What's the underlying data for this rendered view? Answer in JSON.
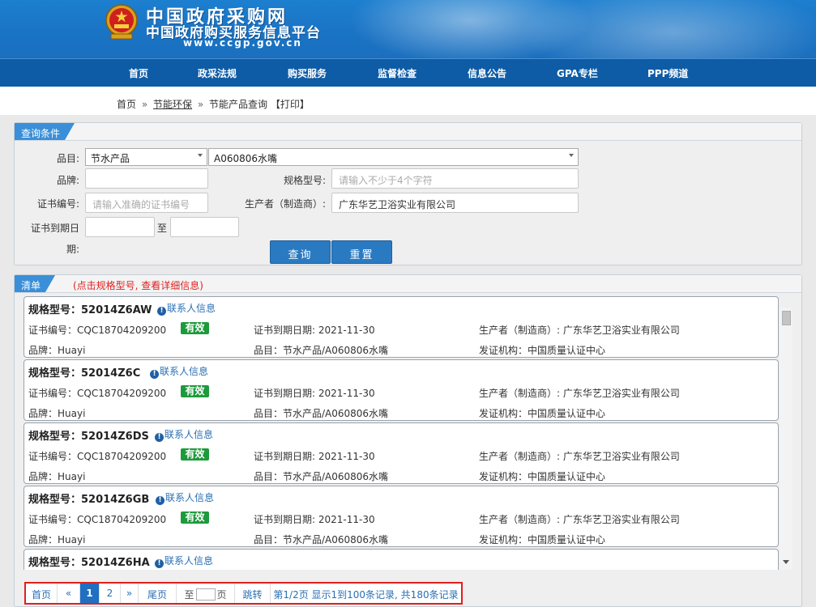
{
  "header": {
    "title": "中国政府采购网",
    "subtitle": "中国政府购买服务信息平台",
    "url": "www.ccgp.gov.cn"
  },
  "nav": [
    "首页",
    "政采法规",
    "购买服务",
    "监督检查",
    "信息公告",
    "GPA专栏",
    "PPP频道"
  ],
  "breadcrumb": {
    "home": "首页",
    "sep": "»",
    "section": "节能环保",
    "page": "节能产品查询",
    "print": "【打印】"
  },
  "query": {
    "tab": "查询条件",
    "category_label": "品目:",
    "category_value": "节水产品",
    "subcategory_value": "A060806水嘴",
    "brand_label": "品牌:",
    "brand_value": "",
    "model_label": "规格型号:",
    "model_placeholder": "请输入不少于4个字符",
    "cert_label": "证书编号:",
    "cert_placeholder": "请输入准确的证书编号",
    "producer_label": "生产者（制造商）:",
    "producer_value": "广东华艺卫浴实业有限公司",
    "expiry_label_1": "证书到期日",
    "expiry_label_2": "期:",
    "to": "至",
    "search_button": "查询",
    "reset_button": "重置"
  },
  "list": {
    "tab": "清单",
    "hint": "(点击规格型号, 查看详细信息)",
    "contact_label": "联系人信息",
    "items": [
      {
        "model": "规格型号：52014Z6AW",
        "cert": "证书编号：CQC18704209200",
        "status": "有效",
        "expiry": "证书到期日期: 2021-11-30",
        "producer": "生产者（制造商）: 广东华艺卫浴实业有限公司",
        "brand": "品牌：Huayi",
        "category": "品目：节水产品/A060806水嘴",
        "issuer": "发证机构：中国质量认证中心"
      },
      {
        "model": "规格型号：52014Z6C",
        "cert": "证书编号：CQC18704209200",
        "status": "有效",
        "expiry": "证书到期日期: 2021-11-30",
        "producer": "生产者（制造商）: 广东华艺卫浴实业有限公司",
        "brand": "品牌：Huayi",
        "category": "品目：节水产品/A060806水嘴",
        "issuer": "发证机构：中国质量认证中心"
      },
      {
        "model": "规格型号：52014Z6DS",
        "cert": "证书编号：CQC18704209200",
        "status": "有效",
        "expiry": "证书到期日期: 2021-11-30",
        "producer": "生产者（制造商）: 广东华艺卫浴实业有限公司",
        "brand": "品牌：Huayi",
        "category": "品目：节水产品/A060806水嘴",
        "issuer": "发证机构：中国质量认证中心"
      },
      {
        "model": "规格型号：52014Z6GB",
        "cert": "证书编号：CQC18704209200",
        "status": "有效",
        "expiry": "证书到期日期: 2021-11-30",
        "producer": "生产者（制造商）: 广东华艺卫浴实业有限公司",
        "brand": "品牌：Huayi",
        "category": "品目：节水产品/A060806水嘴",
        "issuer": "发证机构：中国质量认证中心"
      },
      {
        "model": "规格型号：52014Z6HA",
        "cert": "",
        "status": "",
        "expiry": "",
        "producer": "",
        "brand": "",
        "category": "",
        "issuer": ""
      }
    ]
  },
  "pager": {
    "first": "首页",
    "prev": "«",
    "page1": "1",
    "page2": "2",
    "next": "»",
    "last": "尾页",
    "goto_prefix": "至",
    "goto_suffix": "页",
    "jump": "跳转",
    "summary": "第1/2页 显示1到100条记录, 共180条记录"
  }
}
